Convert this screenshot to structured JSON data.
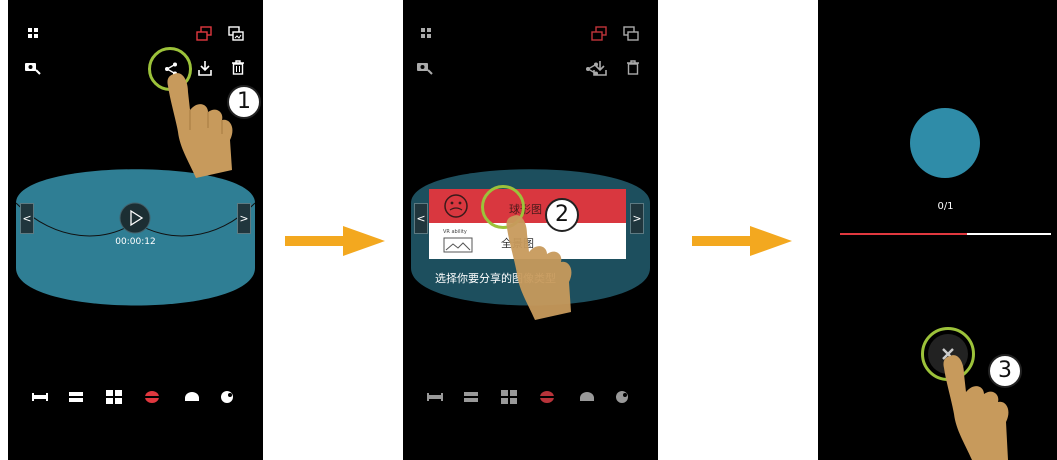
{
  "screen1": {
    "timestamp": "00:00:12",
    "step_number": "1",
    "nav_prev": "<",
    "nav_next": ">"
  },
  "screen2": {
    "popup_option_sphere": "球形图",
    "popup_option_vr_caption": "VR ability",
    "popup_option_panorama": "全景图",
    "popup_hint": "选择你要分享的图像类型",
    "step_number": "2",
    "nav_prev": "<",
    "nav_next": ">"
  },
  "screen3": {
    "progress_text": "0/1",
    "progress_fraction": 0.6,
    "step_number": "3"
  },
  "colors": {
    "accent_red": "#d9373f",
    "pano_teal": "#2f7e94",
    "progress_circle": "#2f8ca8",
    "highlight_ring": "#9cc23a",
    "arrow": "#f3a81f"
  },
  "icons": [
    "grid-icon",
    "gallery-icon",
    "photos-icon",
    "camera-switch-icon",
    "share-icon",
    "download-icon",
    "delete-icon",
    "play-icon",
    "view-mode-icons",
    "close-icon"
  ]
}
